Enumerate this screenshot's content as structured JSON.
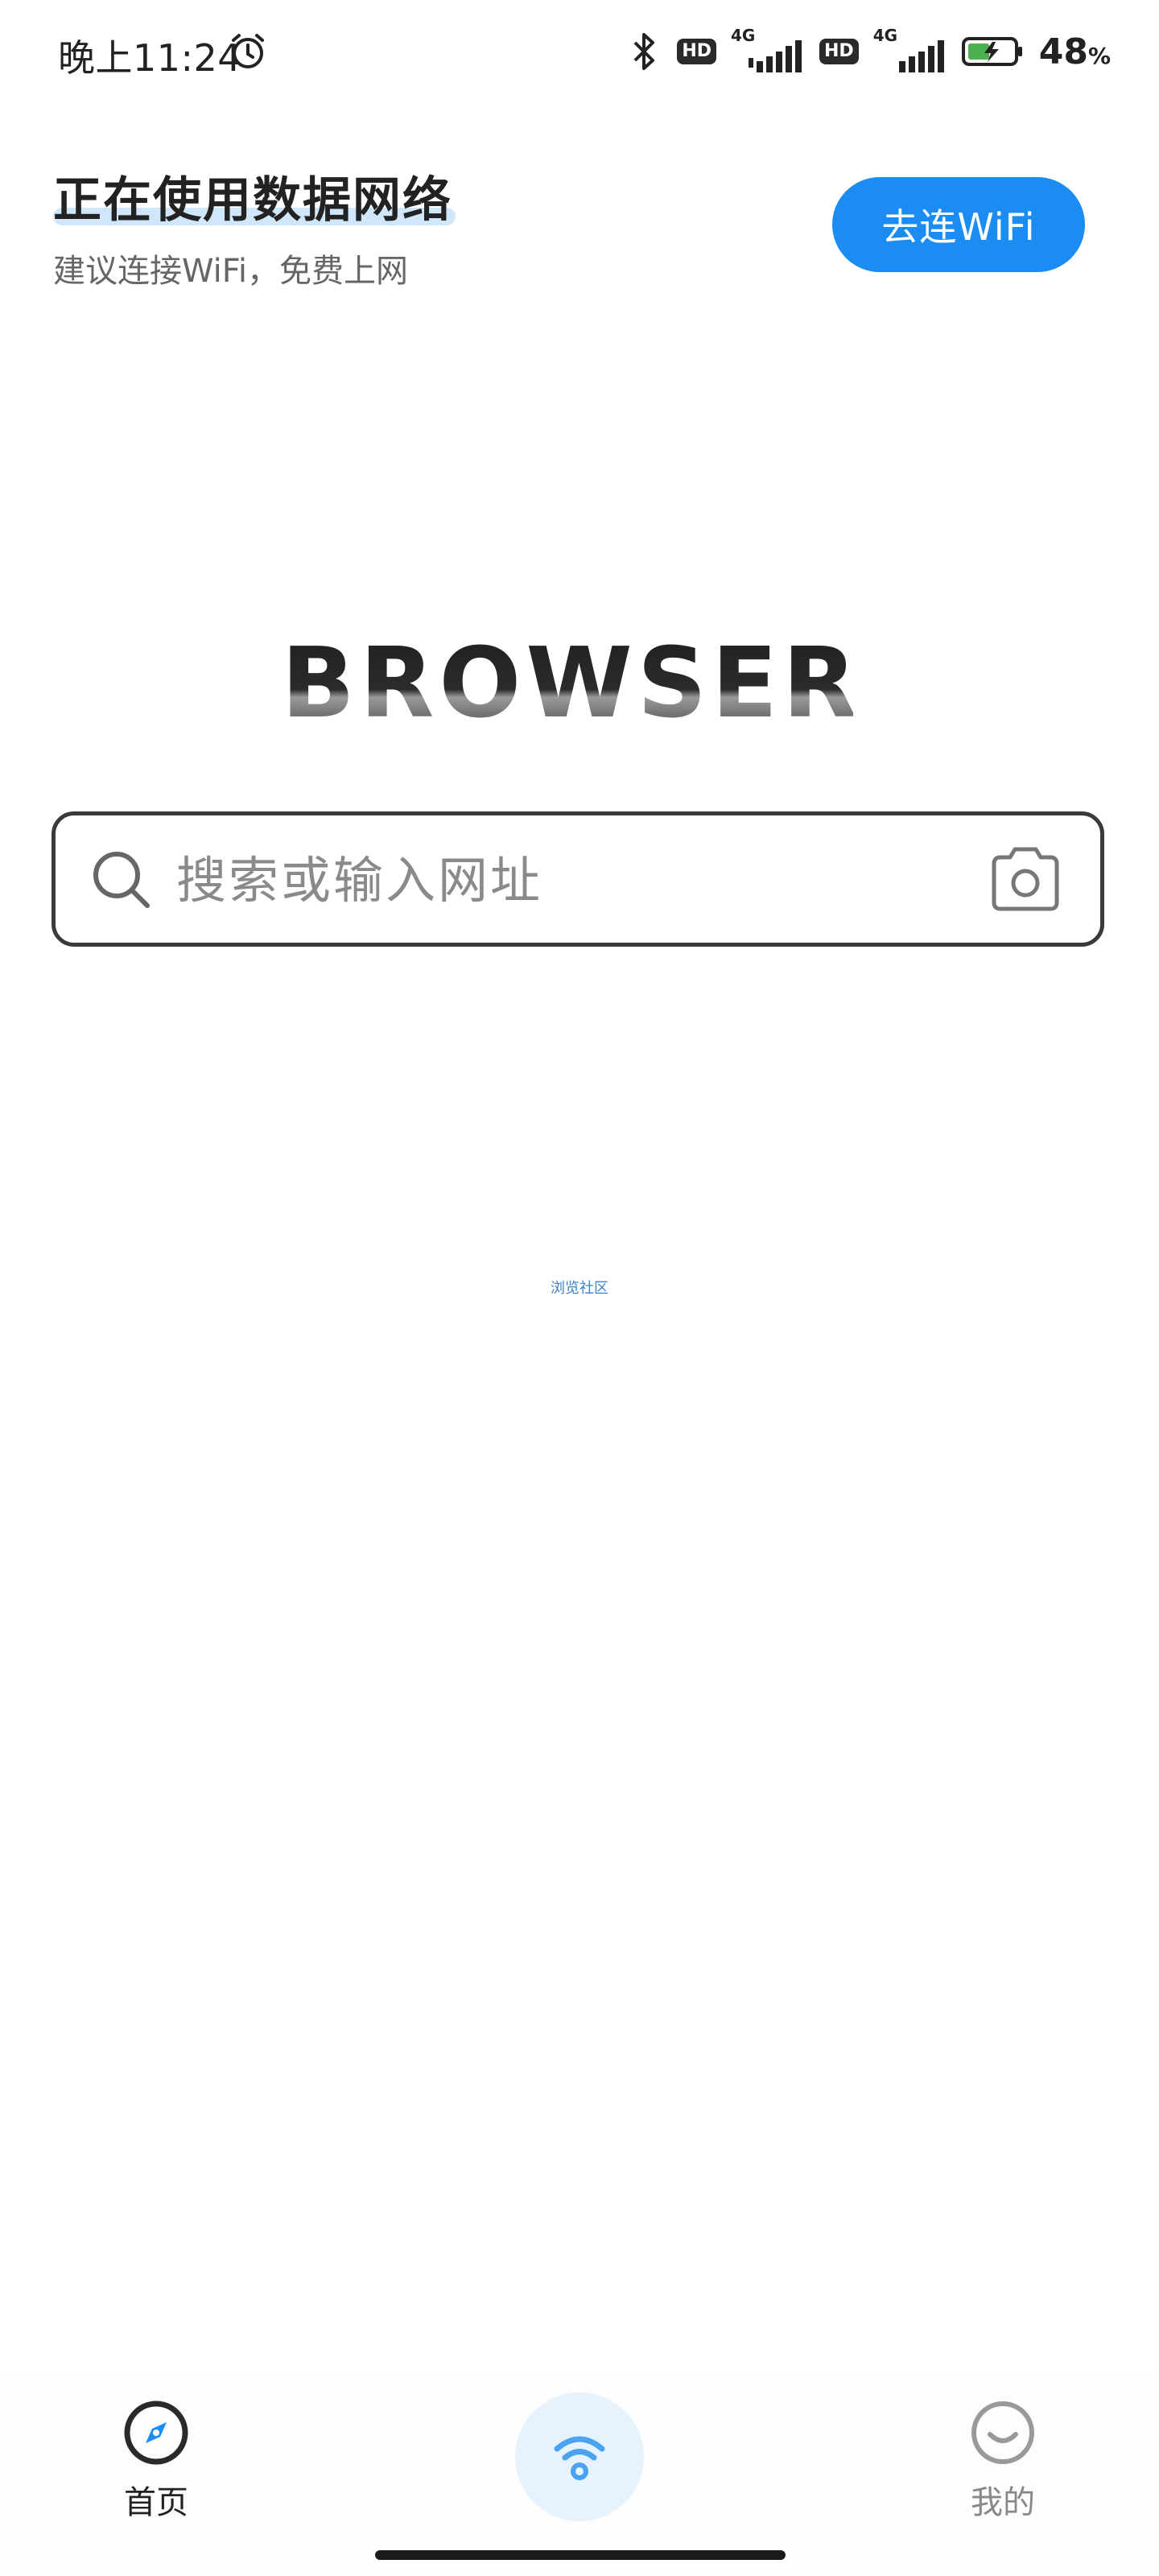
{
  "status_bar": {
    "time": "晚上11:24",
    "hd_1": "HD",
    "net_1": "4G",
    "hd_2": "HD",
    "net_2": "4G",
    "battery_percent": "48",
    "battery_unit": "%",
    "icons": [
      "alarm-icon",
      "bluetooth-icon",
      "signal-icon",
      "battery-charging-icon"
    ]
  },
  "data_notice": {
    "title": "正在使用数据网络",
    "subtitle": "建议连接WiFi，免费上网",
    "button_label": "去连WiFi",
    "accent_color": "#1a8cf2"
  },
  "logo": {
    "text": "BROWSER"
  },
  "search": {
    "placeholder": "搜索或输入网址"
  },
  "community_link": "浏览社区",
  "bottom_nav": {
    "home_label": "首页",
    "mine_label": "我的",
    "center_icon": "wifi-icon"
  }
}
